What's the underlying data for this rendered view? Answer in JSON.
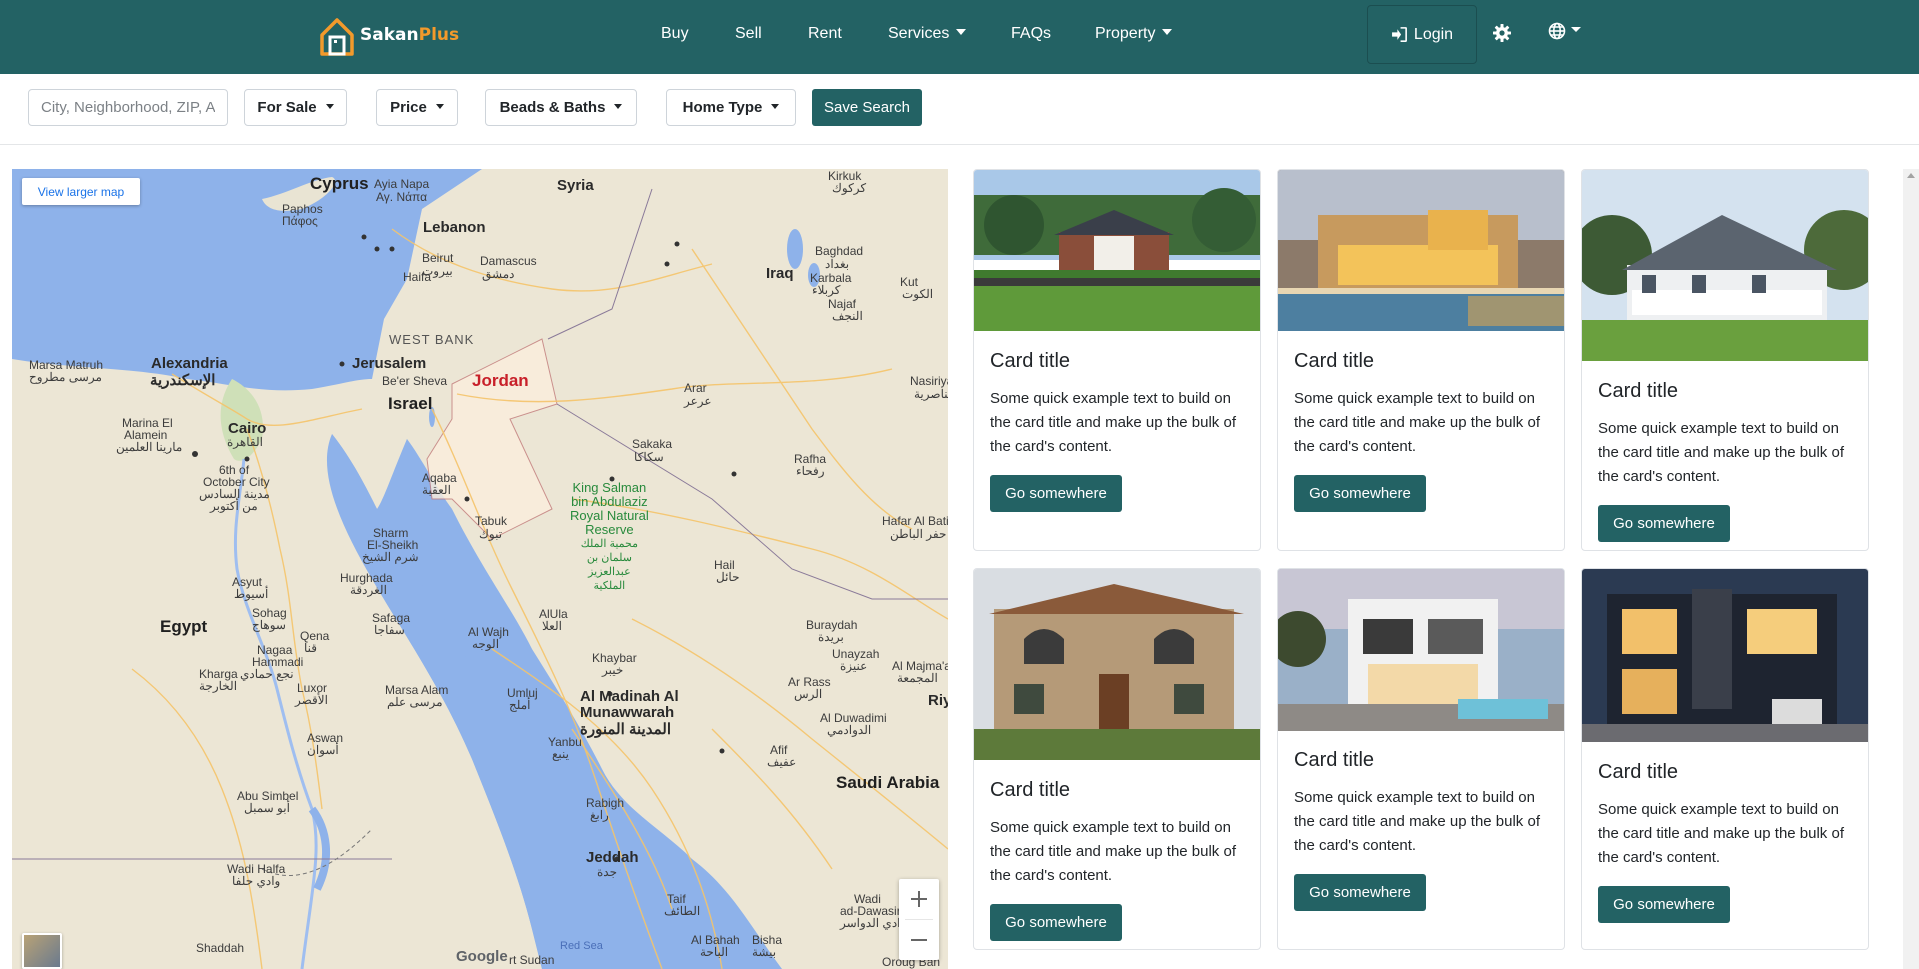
{
  "navbar": {
    "brand": {
      "name_main": "Sakan",
      "name_accent": "Plus"
    },
    "links": [
      {
        "label": "Buy",
        "dropdown": false
      },
      {
        "label": "Sell",
        "dropdown": false
      },
      {
        "label": "Rent",
        "dropdown": false
      },
      {
        "label": "Services",
        "dropdown": true
      },
      {
        "label": "FAQs",
        "dropdown": false
      },
      {
        "label": "Property",
        "dropdown": true
      }
    ],
    "login_label": "Login",
    "icons": [
      "login-icon",
      "gear-icon",
      "globe-icon"
    ],
    "bg_color": "#236264",
    "accent_color": "#f39a2b"
  },
  "filters": {
    "search_placeholder": "City, Neighborhood, ZIP, Address",
    "for_sale": "For Sale",
    "price": "Price",
    "beds_baths": "Beads & Baths",
    "home_type": "Home Type",
    "save_search": "Save Search"
  },
  "map": {
    "view_larger": "View larger map",
    "google": "Google",
    "labels": {
      "cyprus": "Cyprus",
      "ayia_napa": "Ayia Napa",
      "ayia_napa_ar": "Αγ. Νάπα",
      "paphos": "Paphos",
      "paphos_gr": "Πάφος",
      "syria": "Syria",
      "kirkuk": "Kirkuk",
      "kirkuk_ar": "كركوك",
      "lebanon": "Lebanon",
      "beirut": "Beirut",
      "beirut_ar": "بيروت",
      "damascus": "Damascus",
      "damascus_ar": "دمشق",
      "baghdad": "Baghdad",
      "baghdad_ar": "بغداد",
      "iraq": "Iraq",
      "karbala": "Karbala",
      "karbala_ar": "كربلاء",
      "kut": "Kut",
      "kut_ar": "الكوت",
      "haifa": "Haifa",
      "najaf": "Najaf",
      "najaf_ar": "النجف",
      "west_bank": "WEST BANK",
      "marsa_matruh": "Marsa Matruh",
      "marsa_matruh_ar": "مرسى مطروح",
      "alexandria": "Alexandria",
      "alexandria_ar": "الإسكندرية",
      "jerusalem": "Jerusalem",
      "beer_sheva": "Be'er Sheva",
      "jordan": "Jordan",
      "israel": "Israel",
      "arar": "Arar",
      "arar_ar": "عرعر",
      "nasiriya": "Nasiriya",
      "nasiriya_ar": "الناصرية",
      "marina_el_alamein": "Marina El",
      "marina_el_alamein2": "Alamein",
      "marina_el_alamein_ar": "مارينا العلمين",
      "cairo": "Cairo",
      "cairo_ar": "القاهرة",
      "sakaka": "Sakaka",
      "sakaka_ar": "سكاكا",
      "rafha": "Rafha",
      "rafha_ar": "رفحاء",
      "october": "6th of",
      "october2": "October City",
      "october_ar": "مدينة السادس",
      "october_ar2": "من أكتوبر",
      "aqaba": "Aqaba",
      "aqaba_ar": "العقبة",
      "king_salman1": "King Salman",
      "king_salman2": "bin Abdulaziz",
      "king_salman3": "Royal Natural",
      "king_salman4": "Reserve",
      "king_salman_ar1": "محمية الملك",
      "king_salman_ar2": "سلمان بن",
      "king_salman_ar3": "عبدالعزيز",
      "king_salman_ar4": "الملكية",
      "sharm": "Sharm",
      "sharm2": "El-Sheikh",
      "sharm_ar": "شرم الشيخ",
      "tabuk": "Tabuk",
      "tabuk_ar": "تبوك",
      "hafar": "Hafar Al Batin",
      "hafar_ar": "حفر الباطن",
      "hail": "Hail",
      "hail_ar": "حائل",
      "asyut": "Asyut",
      "asyut_ar": "أسيوط",
      "hurghada": "Hurghada",
      "hurghada_ar": "الغردقة",
      "sohag": "Sohag",
      "sohag_ar": "سوهاج",
      "safaga": "Safaga",
      "safaga_ar": "سفاجا",
      "alula": "AlUla",
      "alula_ar": "العلا",
      "egypt": "Egypt",
      "al_wajh": "Al Wajh",
      "al_wajh_ar": "الوجه",
      "buraydah": "Buraydah",
      "buraydah_ar": "بريدة",
      "qena": "Qena",
      "qena_ar": "قنا",
      "nagaa": "Nagaa",
      "nagaa2": "Hammadi",
      "nagaa_ar": "نجع حمادي",
      "kharga": "Kharga",
      "kharga_ar": "الخارجة",
      "unayzah": "Unayzah",
      "unayzah_ar": "عنيزة",
      "khaybar": "Khaybar",
      "khaybar_ar": "خيبر",
      "al_majmaah": "Al Majma'ah",
      "al_majmaah_ar": "المجمعة",
      "luxor": "Luxor",
      "luxor_ar": "الأقصر",
      "marsa_alam": "Marsa Alam",
      "marsa_alam_ar": "مرسى علم",
      "umluj": "Umluj",
      "umluj_ar": "أملج",
      "al_rass": "Ar Rass",
      "al_rass_ar": "الرس",
      "al_madinah": "Al Madinah Al",
      "al_madinah2": "Munawwarah",
      "al_madinah_ar": "المدينة المنورة",
      "aswan": "Aswan",
      "aswan_ar": "أسوان",
      "al_duwadimi": "Al Duwadimi",
      "al_duwadimi_ar": "الدوادمي",
      "riy": "Riy",
      "yanbu": "Yanbu",
      "yanbu_ar": "ينبع",
      "afif": "Afif",
      "afif_ar": "عفيف",
      "saudi_arabia": "Saudi Arabia",
      "abu_simbel": "Abu Simbel",
      "abu_simbel_ar": "أبو سمبل",
      "rabigh": "Rabigh",
      "rabigh_ar": "رابغ",
      "wadi_halfa": "Wadi Halfa",
      "wadi_halfa_ar": "وادي حلفا",
      "jeddah": "Jeddah",
      "jeddah_ar": "جدة",
      "taif": "Taif",
      "taif_ar": "الطائف",
      "wadi_dawasir": "Wadi",
      "wadi_dawasir2": "ad-Dawasir",
      "wadi_dawasir_ar": "وادي الدواسر",
      "shaddah": "Shaddah",
      "port_sudan": "rt Sudan",
      "red_sea": "Red Sea",
      "al_bahah": "Al Bahah",
      "al_bahah_ar": "الباحة",
      "bisha": "Bisha",
      "bisha_ar": "بيشة",
      "oroug": "Oroug Ban"
    }
  },
  "cards": [
    {
      "title": "Card title",
      "text": "Some quick example text to build on the card title and make up the bulk of the card's content.",
      "button": "Go somewhere"
    },
    {
      "title": "Card title",
      "text": "Some quick example text to build on the card title and make up the bulk of the card's content.",
      "button": "Go somewhere"
    },
    {
      "title": "Card title",
      "text": "Some quick example text to build on the card title and make up the bulk of the card's content.",
      "button": "Go somewhere"
    },
    {
      "title": "Card title",
      "text": "Some quick example text to build on the card title and make up the bulk of the card's content.",
      "button": "Go somewhere"
    },
    {
      "title": "Card title",
      "text": "Some quick example text to build on the card title and make up the bulk of the card's content.",
      "button": "Go somewhere"
    },
    {
      "title": "Card title",
      "text": "Some quick example text to build on the card title and make up the bulk of the card's content.",
      "button": "Go somewhere"
    }
  ]
}
